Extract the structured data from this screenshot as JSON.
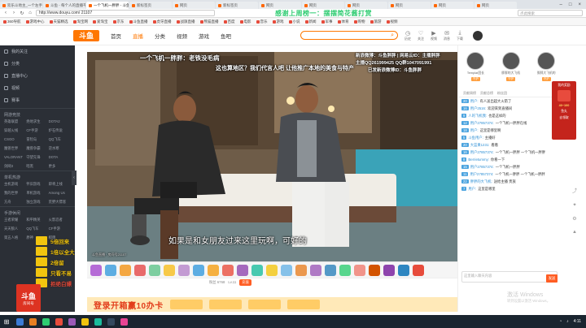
{
  "browser": {
    "tabs": [
      {
        "label": "欢乐斗地主_一个左手..."
      },
      {
        "label": "斗鱼 - 每个人的直播平台"
      },
      {
        "label": "一个飞机一胖胖 - 斗鱼"
      },
      {
        "label": "新标签页"
      },
      {
        "label": "网页"
      },
      {
        "label": "新标签页"
      },
      {
        "label": "网页"
      },
      {
        "label": "网页"
      },
      {
        "label": "网页"
      },
      {
        "label": "网页"
      },
      {
        "label": "网页"
      },
      {
        "label": "网页"
      }
    ],
    "url": "http://www.douyu.com/ 21107",
    "promo_text": "感谢上周榜一：摆摆简花酱打赏",
    "search_placeholder": "点此搜索",
    "bookmarks": [
      "360导航",
      "游戏中心",
      "天猫精选",
      "淘宝网",
      "爱淘宝",
      "京东",
      "斗鱼直播",
      "虎牙直播",
      "战旗直播",
      "熊猫直播",
      "百度",
      "电影",
      "音乐",
      "游戏",
      "小说",
      "新闻",
      "军事",
      "体育",
      "购物",
      "旅游",
      "视频"
    ]
  },
  "header": {
    "logo": "斗鱼",
    "nav": [
      "首页",
      "直播",
      "分类",
      "视频",
      "游戏",
      "鱼吧"
    ],
    "search_icon": "search-icon",
    "icons": [
      {
        "name": "history-icon",
        "label": "历史"
      },
      {
        "name": "follow-icon",
        "label": "关注"
      },
      {
        "name": "video-icon",
        "label": "视频"
      },
      {
        "name": "message-icon",
        "label": "消息"
      },
      {
        "name": "download-icon",
        "label": "下载"
      }
    ]
  },
  "sidebar": {
    "items": [
      {
        "icon": "follow-icon",
        "label": "我的关注"
      },
      {
        "icon": "category-icon",
        "label": "分类"
      },
      {
        "icon": "live-icon",
        "label": "直播中心"
      },
      {
        "icon": "video-icon",
        "label": "视频"
      },
      {
        "icon": "game-icon",
        "label": "赛事"
      }
    ],
    "sections": [
      {
        "title": "网游竞技",
        "items": [
          "英雄联盟",
          "绝地求生",
          "DOTA2",
          "穿越火线",
          "CF手游",
          "炉石传说",
          "CSGO",
          "冒险岛",
          "QQ飞车",
          "魔兽世界",
          "魔兽争霸",
          "逆水寒",
          "VALORANT",
          "守望先锋",
          "DOTA",
          "剑网3",
          "暗黑",
          "更多"
        ]
      },
      {
        "title": "单机热游",
        "items": [
          "主机游戏",
          "怀旧游戏",
          "即将上线",
          "我的世界",
          "单机游戏",
          "Among Us",
          "方舟",
          "独立游戏",
          "荒野大镖客"
        ]
      },
      {
        "title": "手游休闲",
        "items": [
          "王者荣耀",
          "和平精英",
          "火影忍者",
          "天天狼人",
          "QQ飞车",
          "CF手游",
          "第五人格",
          "原神",
          "棋牌"
        ]
      }
    ]
  },
  "video": {
    "overlay_title": "一个飞机一胖胖：老铁没毛病",
    "overlay_slogan": "这也算地区？我们代言人吧 让他推广本地的美食与特产",
    "overlay_contact1": "新浪微博：斗鱼胖胖 | 网易云ID：主播胖胖",
    "overlay_contact2": "主播QQ261999425 QQ群1047091991",
    "overlay_contact3": "已发新浪微博ID：斗鱼胖胖",
    "subtitle": "如果是和女朋友过来这里玩啊，可好的",
    "watermark": "斗鱼直播 · 房间号21107"
  },
  "gift_bar": {
    "gift_colors": [
      "#b56bd6",
      "#5dade2",
      "#f4a742",
      "#e86a6a",
      "#7dcea0",
      "#f7c948",
      "#c39bd3",
      "#5dade2",
      "#f5b041",
      "#ec7063",
      "#a569bd",
      "#48c9b0",
      "#f4d03f",
      "#85c1e9",
      "#eb984e",
      "#af7ac5",
      "#5499c7",
      "#58d68d",
      "#f1948a",
      "#d35400",
      "#8e44ad",
      "#2e86c1",
      "#e74c3c"
    ]
  },
  "bottom_bar": {
    "fans": "粉丝 6768",
    "level": "Lv.11",
    "recharge": "充值"
  },
  "banner": {
    "text": "登录开箱赢10办卡"
  },
  "overlay_ads": [
    {
      "label": "5倍回来",
      "color": "yellow"
    },
    {
      "label": "1倍以全大",
      "color": "yellow"
    },
    {
      "label": "2倍留",
      "color": "yellow"
    },
    {
      "label": "只看不易",
      "color": "yellow"
    },
    {
      "label": "拒绝白嫖",
      "color": "red"
    }
  ],
  "big_logo": {
    "title": "斗鱼",
    "room": "房间号"
  },
  "right_panel": {
    "ranks": [
      {
        "name": "Templar团长",
        "tag": "守护"
      },
      {
        "name": "胖胖的大飞机",
        "tag": "守护"
      },
      {
        "name": "胖胖大飞机的",
        "tag": "守护"
      }
    ],
    "rank_tabs": [
      "贡献周榜",
      "贡献总榜",
      "粉丝团"
    ],
    "chat": [
      {
        "lv": "20",
        "user": "用户",
        "text": "有人送出超大火箭了"
      },
      {
        "lv": "16",
        "user": "用户2516",
        "text": "欢迎来到直播间"
      },
      {
        "lv": "9",
        "user": "人的飞机我",
        "text": "也是这样的"
      },
      {
        "lv": "12",
        "user": "用户27857374",
        "text": "一个飞机一胖胖在线"
      },
      {
        "lv": "18",
        "user": "用户",
        "text": "这里是哪里啊"
      },
      {
        "lv": "5",
        "user": "斗鱼用户",
        "text": "主播好"
      },
      {
        "lv": "20",
        "user": "大蓝果1231",
        "text": "看看"
      },
      {
        "lv": "16",
        "user": "用户27857374",
        "text": "一个飞机一胖胖 一个飞机一胖胖"
      },
      {
        "lv": "8",
        "user": "Berrietummy",
        "text": "你看一下"
      },
      {
        "lv": "15",
        "user": "用户27857374",
        "text": "一个飞机一胖胖"
      },
      {
        "lv": "11",
        "user": "用户27857374",
        "text": "一个飞机一胖胖 一个飞机一胖胖"
      },
      {
        "lv": "22",
        "user": "胖胖的大飞机",
        "text": "送给主播 贵族"
      },
      {
        "lv": "7",
        "user": "用户",
        "text": "这里是哪里"
      }
    ],
    "chat_placeholder": "这里输入聊天内容",
    "send_label": "发送",
    "windows_watermark": "激活 Windows",
    "windows_watermark_sub": "转到设置以激活 Windows。"
  },
  "float_card": {
    "title": "我的奖励",
    "amount": "40~100",
    "label": "鱼丸",
    "cta": "去领取"
  },
  "taskbar": {
    "start_icon": "windows-icon",
    "app_colors": [
      "#3b7bd6",
      "#e67e22",
      "#2ecc71",
      "#e74c3c",
      "#9b59b6",
      "#f1c40f",
      "#1abc9c",
      "#34495e",
      "#e84393"
    ],
    "tray_time": "4:11"
  }
}
